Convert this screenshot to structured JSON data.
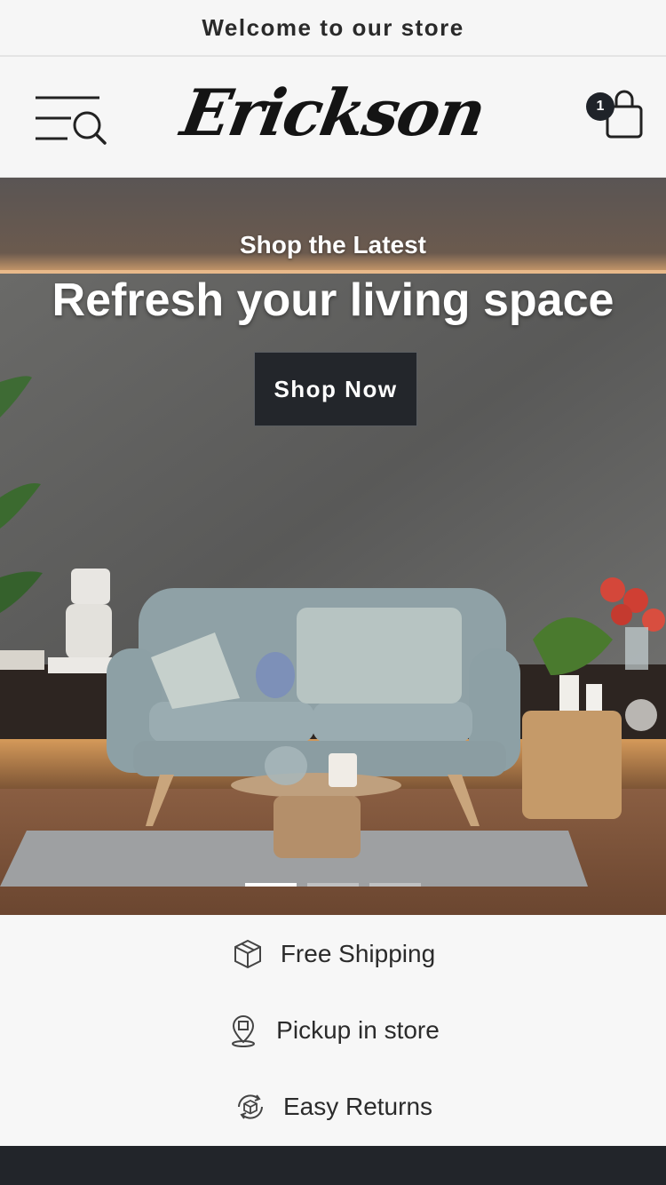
{
  "announcement": {
    "text": "Welcome to our store"
  },
  "header": {
    "logo_text": "Erickson",
    "cart_count": "1",
    "menu_icon": "menu-search-icon",
    "cart_icon": "bag-icon"
  },
  "hero": {
    "kicker": "Shop the Latest",
    "title": "Refresh your living space",
    "button_label": "Shop Now",
    "slide_count": 3,
    "active_slide": 1
  },
  "features": [
    {
      "label": "Free Shipping",
      "icon": "box-icon"
    },
    {
      "label": "Pickup in store",
      "icon": "map-pin-icon"
    },
    {
      "label": "Easy Returns",
      "icon": "return-box-icon"
    }
  ],
  "colors": {
    "button_bg": "#23262b",
    "footer_bg": "#22252a",
    "background": "#f6f6f6"
  }
}
